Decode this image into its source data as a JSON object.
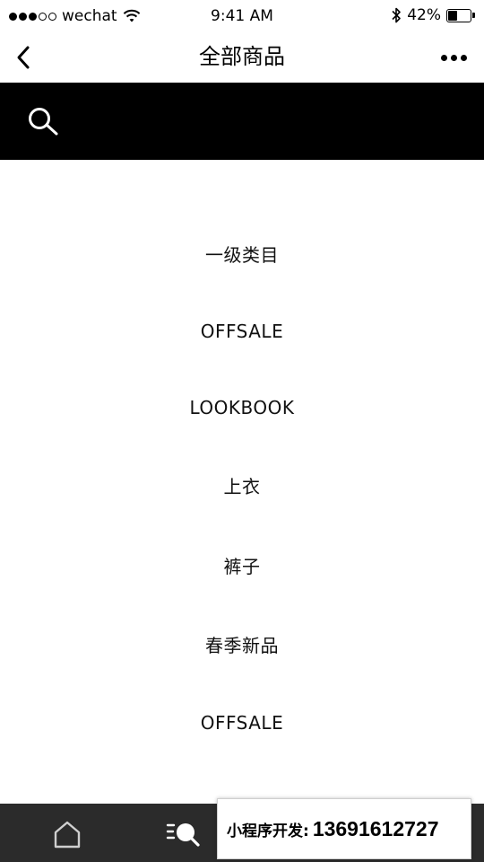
{
  "status_bar": {
    "signal_filled": 3,
    "signal_total": 5,
    "carrier": "wechat",
    "time": "9:41 AM",
    "battery_percent": "42%",
    "battery_level": 0.42
  },
  "nav": {
    "title": "全部商品"
  },
  "icons": {
    "back": "chevron-left-icon",
    "more": "more-dots-icon",
    "search": "search-icon",
    "home": "home-icon",
    "tab_search": "list-search-icon"
  },
  "categories": [
    {
      "label": "一级类目"
    },
    {
      "label": "OFFSALE"
    },
    {
      "label": "LOOKBOOK"
    },
    {
      "label": "上衣"
    },
    {
      "label": "裤子"
    },
    {
      "label": "春季新品"
    },
    {
      "label": "OFFSALE"
    }
  ],
  "promo": {
    "label": "小程序开发:",
    "phone": "13691612727"
  },
  "colors": {
    "search_bar_bg": "#000000",
    "tab_bar_bg": "#2b2b2b",
    "text": "#111111"
  }
}
